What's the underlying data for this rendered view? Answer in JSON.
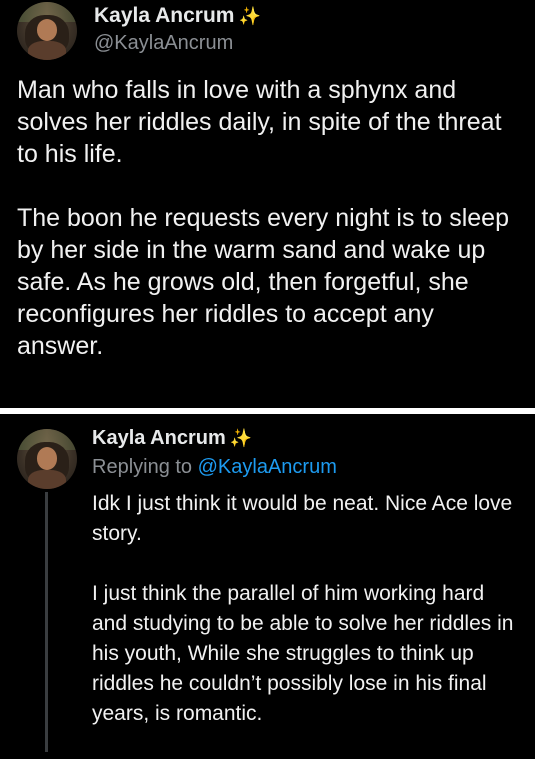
{
  "tweet1": {
    "name": "Kayla Ancrum",
    "sparkle": "✨",
    "handle": "@KaylaAncrum",
    "paragraphs": [
      "Man who falls in love with a sphynx and solves her riddles daily, in spite of the threat to his life.",
      "The boon he requests every night is to sleep by her side in the warm sand and wake up safe. As he grows old, then forgetful, she reconfigures her riddles to accept any answer."
    ]
  },
  "tweet2": {
    "name": "Kayla Ancrum",
    "sparkle": "✨",
    "replying_prefix": "Replying to",
    "replying_to": "@KaylaAncrum",
    "paragraphs": [
      "Idk I just think it would be neat. Nice Ace love story.",
      "I just think the parallel of him working hard and studying to be able to solve her riddles in his youth, While she struggles to think up riddles he couldn’t possibly lose in his final years, is romantic."
    ]
  },
  "colors": {
    "background": "#000000",
    "text": "#e7e9ea",
    "secondary": "#8b8f94",
    "link": "#1d9bf0",
    "divider": "#ffffff"
  }
}
